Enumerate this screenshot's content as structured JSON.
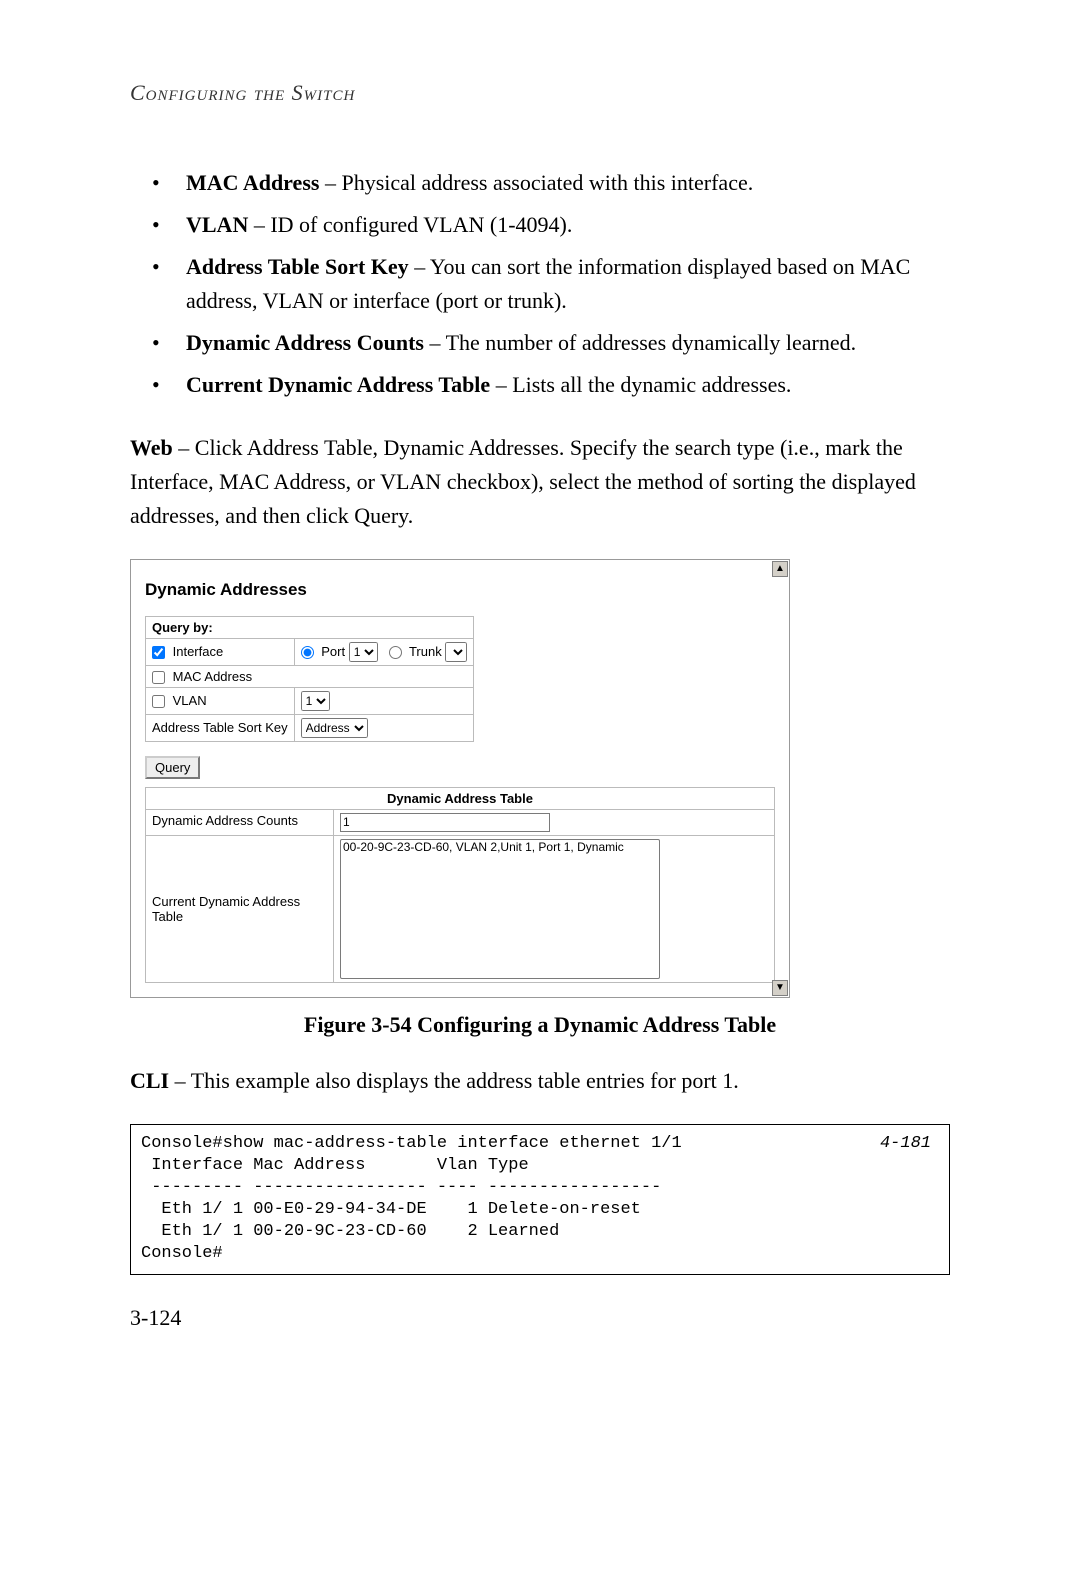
{
  "running_head": "Configuring the Switch",
  "bullets": [
    {
      "term": "MAC Address",
      "desc": " – Physical address associated with this interface."
    },
    {
      "term": "VLAN",
      "desc": " – ID of configured VLAN (1-4094)."
    },
    {
      "term": "Address Table Sort Key",
      "desc": " – You can sort the information displayed based on MAC address, VLAN or interface (port or trunk)."
    },
    {
      "term": "Dynamic Address Counts",
      "desc": " – The number of addresses dynamically learned."
    },
    {
      "term": "Current Dynamic Address Table",
      "desc": " – Lists all the dynamic addresses."
    }
  ],
  "web_para_lead": "Web",
  "web_para": " – Click Address Table, Dynamic Addresses. Specify the search type (i.e., mark the Interface, MAC Address, or VLAN checkbox), select the method of sorting the displayed addresses, and then click Query.",
  "figure": {
    "title": "Dynamic Addresses",
    "query_by_label": "Query by:",
    "interface_label": "Interface",
    "port_label": "Port",
    "port_value": "1",
    "trunk_label": "Trunk",
    "mac_label": "MAC Address",
    "vlan_label": "VLAN",
    "vlan_value": "1",
    "sortkey_label": "Address Table Sort Key",
    "sortkey_value": "Address",
    "query_button": "Query",
    "dat_title": "Dynamic Address Table",
    "counts_label": "Dynamic Address Counts",
    "counts_value": "1",
    "current_label": "Current Dynamic Address Table",
    "entry": "00-20-9C-23-CD-60, VLAN 2,Unit 1, Port 1, Dynamic"
  },
  "figcap": "Figure 3-54  Configuring a Dynamic Address Table",
  "cli_para_lead": "CLI",
  "cli_para": " – This example also displays the address table entries for port 1.",
  "cli_ref": "4-181",
  "cli_text": "Console#show mac-address-table interface ethernet 1/1\n Interface Mac Address       Vlan Type\n --------- ----------------- ---- -----------------\n  Eth 1/ 1 00-E0-29-94-34-DE    1 Delete-on-reset\n  Eth 1/ 1 00-20-9C-23-CD-60    2 Learned\nConsole#",
  "pagenum": "3-124"
}
